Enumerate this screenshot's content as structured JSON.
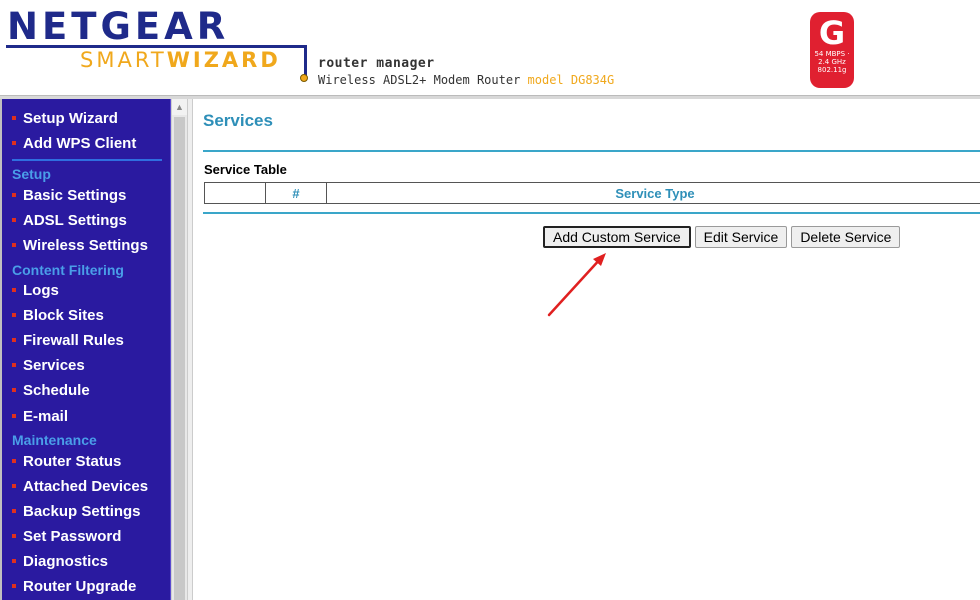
{
  "header": {
    "brand": "NETGEAR",
    "product_light": "SMART",
    "product_bold": "WIZARD",
    "subtitle": "router manager",
    "device": "Wireless ADSL2+ Modem Router",
    "model": "model DG834G",
    "badge_letter": "G",
    "badge_text": "54 MBPS · 2.4 GHz 802.11g"
  },
  "sidebar": {
    "items": [
      {
        "label": "Setup Wizard"
      },
      {
        "label": "Add WPS Client"
      }
    ],
    "sections": [
      {
        "title": "Setup",
        "items": [
          "Basic Settings",
          "ADSL Settings",
          "Wireless Settings"
        ]
      },
      {
        "title": "Content Filtering",
        "items": [
          "Logs",
          "Block Sites",
          "Firewall Rules",
          "Services",
          "Schedule",
          "E-mail"
        ]
      },
      {
        "title": "Maintenance",
        "items": [
          "Router Status",
          "Attached Devices",
          "Backup Settings",
          "Set Password",
          "Diagnostics",
          "Router Upgrade"
        ]
      }
    ]
  },
  "main": {
    "title": "Services",
    "table_title": "Service Table",
    "columns": [
      "",
      "#",
      "Service Type"
    ],
    "rows": [],
    "buttons": {
      "add": "Add Custom Service",
      "edit": "Edit Service",
      "delete": "Delete Service"
    }
  },
  "colors": {
    "sidebar_bg": "#2a1aa0",
    "section_title": "#4a9ee8",
    "page_accent": "#2e8fb8",
    "annotation_arrow": "#e02020"
  }
}
